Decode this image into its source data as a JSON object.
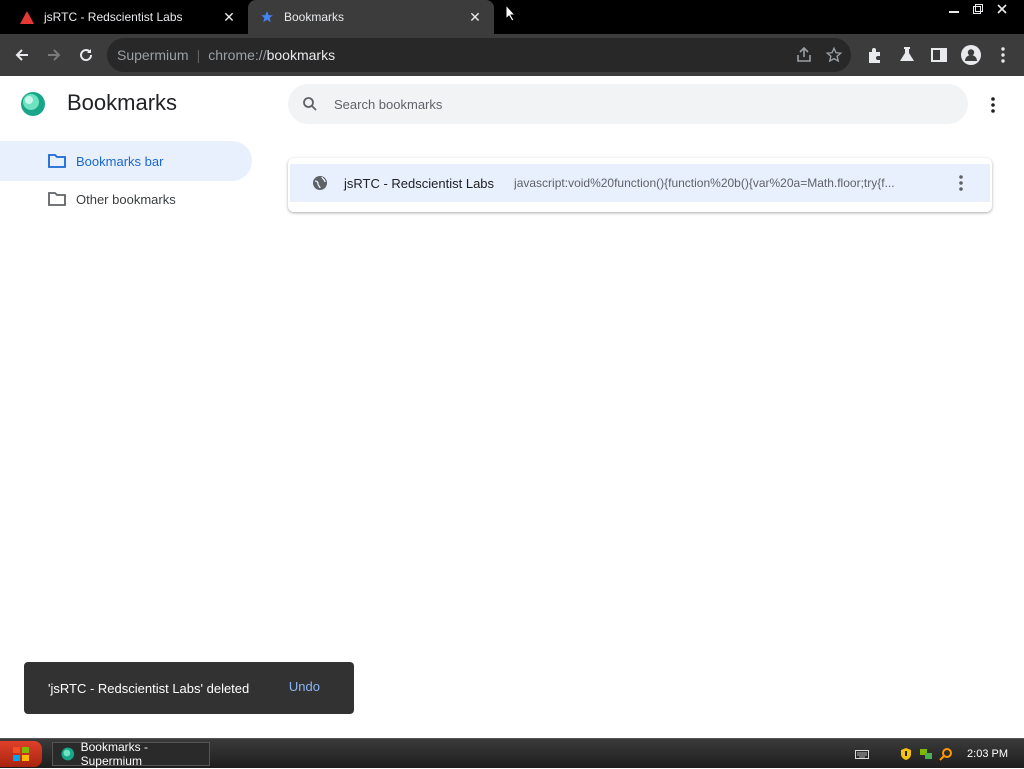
{
  "tabs": [
    {
      "title": "jsRTC - Redscientist Labs",
      "active": false
    },
    {
      "title": "Bookmarks",
      "active": true
    }
  ],
  "omnibox": {
    "host": "Supermium",
    "separator": "|",
    "scheme": "chrome://",
    "path": "bookmarks"
  },
  "page": {
    "title": "Bookmarks",
    "search_placeholder": "Search bookmarks"
  },
  "sidebar": {
    "items": [
      {
        "label": "Bookmarks bar",
        "active": true
      },
      {
        "label": "Other bookmarks",
        "active": false
      }
    ]
  },
  "bookmarks": [
    {
      "title": "jsRTC - Redscientist Labs",
      "url": "javascript:void%20function(){function%20b(){var%20a=Math.floor;try{f..."
    }
  ],
  "toast": {
    "message": "'jsRTC - Redscientist Labs' deleted",
    "action": "Undo"
  },
  "taskbar": {
    "item": "Bookmarks - Supermium",
    "clock": "2:03 PM"
  },
  "colors": {
    "accent": "#1967d2",
    "selected_bg": "#e8f0fe",
    "toast_bg": "#323232",
    "undo": "#8ab4f8"
  }
}
